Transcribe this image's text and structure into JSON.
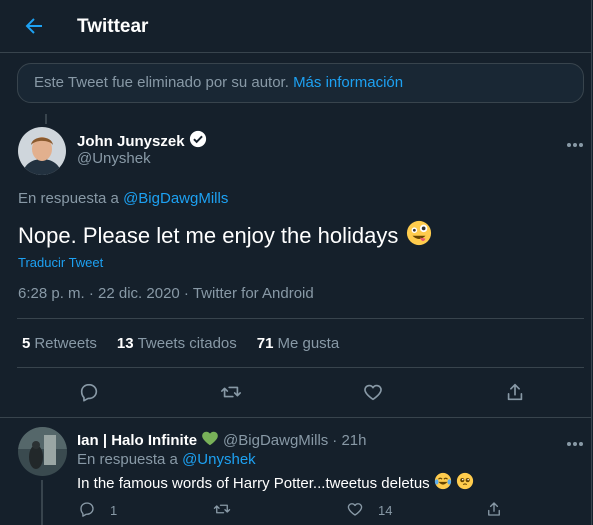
{
  "header": {
    "title": "Twittear"
  },
  "deleted_notice": {
    "text": "Este Tweet fue eliminado por su autor.",
    "link": "Más información"
  },
  "tweet": {
    "name": "John Junyszek",
    "handle": "@Unyshek",
    "reply_prefix": "En respuesta a",
    "reply_to": "@BigDawgMills",
    "text": "Nope. Please let me enjoy the holidays",
    "translate": "Traducir Tweet",
    "meta": "6:28 p. m. · 22 dic. 2020 · Twitter for Android",
    "stats": {
      "retweets_count": "5",
      "retweets_label": "Retweets",
      "quotes_count": "13",
      "quotes_label": "Tweets citados",
      "likes_count": "71",
      "likes_label": "Me gusta"
    }
  },
  "reply": {
    "name": "Ian | Halo Infinite",
    "handle": "@BigDawgMills",
    "time": "· 21h",
    "reply_prefix": "En respuesta a",
    "reply_to": "@Unyshek",
    "text": "In the famous words of Harry Potter...tweetus deletus",
    "reply_count": "1",
    "like_count": "14"
  },
  "colors": {
    "background": "#15202b",
    "accent": "#1da1f2",
    "muted": "#8899a6",
    "border": "#38444d"
  },
  "icons": [
    "back-arrow-icon",
    "verified-icon",
    "more-icon",
    "reply-icon",
    "retweet-icon",
    "like-icon",
    "share-icon",
    "green-heart-icon"
  ]
}
